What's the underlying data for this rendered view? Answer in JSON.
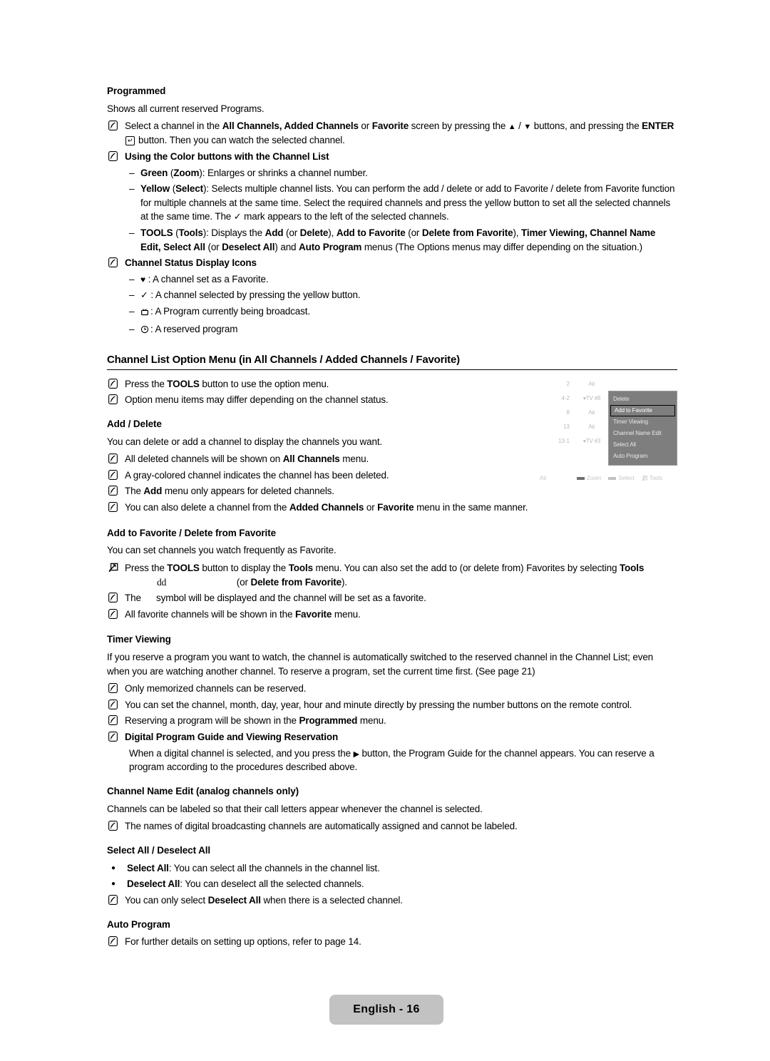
{
  "page": {
    "footer_label": "English - 16"
  },
  "programmed": {
    "heading": "Programmed",
    "intro": "Shows all current reserved Programs.",
    "note1_a": "Select a channel in the ",
    "note1_b": "All Channels, Added Channels",
    "note1_c": " or ",
    "note1_d": "Favorite",
    "note1_e": " screen by pressing the ",
    "note1_up": "▲",
    "note1_slash": " / ",
    "note1_down": "▼",
    "note1_f": " buttons, and pressing the ",
    "note1_enter": "ENTER",
    "note1_enter_glyph": "↵",
    "note1_g": " button. Then you can watch the selected channel.",
    "note2": "Using the Color buttons with the Channel List",
    "dash_green_a": "Green",
    "dash_green_b": " (",
    "dash_green_c": "Zoom",
    "dash_green_d": "): Enlarges or shrinks a channel number.",
    "dash_yellow_a": "Yellow",
    "dash_yellow_b": " (",
    "dash_yellow_c": "Select",
    "dash_yellow_d": "): Selects multiple channel lists. You can perform the add / delete or add to Favorite / delete from Favorite function for multiple channels at the same time. Select the required channels and press the yellow button to set all the selected channels at the same time. The ",
    "dash_yellow_check": "✓",
    "dash_yellow_e": " mark appears to the left of the selected channels.",
    "dash_tools_a": "TOOLS",
    "dash_tools_b": " (",
    "dash_tools_c": "Tools",
    "dash_tools_d": "): Displays the ",
    "dash_tools_add": "Add",
    "dash_tools_e": " (or ",
    "dash_tools_delete": "Delete",
    "dash_tools_f": "), ",
    "dash_tools_atf": "Add to Favorite",
    "dash_tools_g": " (or ",
    "dash_tools_dff": "Delete from Favorite",
    "dash_tools_h": "), ",
    "dash_tools_tv": "Timer Viewing, Channel Name Edit, Select All",
    "dash_tools_i": " (or ",
    "dash_tools_da": "Deselect All",
    "dash_tools_j": ") and ",
    "dash_tools_ap": "Auto Program",
    "dash_tools_k": " menus (The Options menus may differ depending on the situation.)",
    "note3": "Channel Status Display Icons",
    "status_icons": [
      {
        "glyph": "♥",
        "text": ": A channel set as a Favorite."
      },
      {
        "glyph": "✓",
        "text": ": A channel selected by pressing the yellow button."
      },
      {
        "glyph": "tv-icon",
        "text": ": A Program currently being broadcast."
      },
      {
        "glyph": "clock-icon",
        "text": ": A reserved program"
      }
    ]
  },
  "option_menu": {
    "heading": "Channel List Option Menu (in All Channels / Added Channels / Favorite)",
    "note1_a": "Press the ",
    "note1_b": "TOOLS",
    "note1_c": " button to use the option menu.",
    "note2": "Option menu items may differ depending on the channel status."
  },
  "add_delete": {
    "heading": "Add / Delete",
    "intro": "You can delete or add a channel to display the channels you want.",
    "note1_a": "All deleted channels will be shown on ",
    "note1_b": "All Channels",
    "note1_c": " menu.",
    "note2": "A gray-colored channel indicates the channel has been deleted.",
    "note3_a": "The ",
    "note3_b": "Add",
    "note3_c": " menu only appears for deleted channels.",
    "note4_a": "You can also delete a channel from the ",
    "note4_b": "Added Channels",
    "note4_c": " or ",
    "note4_d": "Favorite",
    "note4_e": " menu in the same manner."
  },
  "favorite": {
    "heading": "Add to Favorite / Delete from Favorite",
    "intro": "You can set channels you watch frequently as Favorite.",
    "note1_a": "Press the ",
    "note1_b": "TOOLS",
    "note1_c": " button to display the ",
    "note1_d": "Tools",
    "note1_e": " menu. You can also set the add to (or delete from) Favorites by selecting ",
    "note1_f": "Tools",
    "note1_g2": "dd",
    "note1_h": " (or ",
    "note1_i": "Delete from Favorite",
    "note1_j": ").",
    "note2_a": "The ",
    "note2_b": " symbol will be displayed and the channel will be set as a favorite.",
    "note3_a": "All favorite channels will be shown in the ",
    "note3_b": "Favorite",
    "note3_c": " menu."
  },
  "timer_viewing": {
    "heading": "Timer Viewing",
    "intro": "If you reserve a program you want to watch, the channel is automatically switched to the reserved channel in the Channel List; even when you are watching another channel. To reserve a program, set the current time first. (See page 21)",
    "note1": "Only memorized channels can be reserved.",
    "note2": "You can set the channel, month, day, year, hour and minute directly by pressing the number buttons on the remote control.",
    "note3_a": "Reserving a program will be shown in the ",
    "note3_b": "Programmed",
    "note3_c": " menu.",
    "note4": "Digital Program Guide and Viewing Reservation",
    "sub_a": "When a digital channel is selected, and you press the ",
    "sub_arrow": "▶",
    "sub_b": " button, the Program Guide for the channel appears. You can reserve a program according to the procedures described above."
  },
  "name_edit": {
    "heading": "Channel Name Edit (analog channels only)",
    "intro": "Channels can be labeled so that their call letters appear whenever the channel is selected.",
    "note1": "The names of digital broadcasting channels are automatically assigned and cannot be labeled."
  },
  "select_all": {
    "heading": "Select All / Deselect All",
    "bullet1_a": "Select All",
    "bullet1_b": ": You can select all the channels in the channel list.",
    "bullet2_a": "Deselect All",
    "bullet2_b": ": You can deselect all the selected channels.",
    "note1_a": "You can only select ",
    "note1_b": "Deselect All",
    "note1_c": " when there is a selected channel."
  },
  "auto_program": {
    "heading": "Auto Program",
    "note1": "For further details on setting up options, refer to page 14."
  },
  "tv_figure": {
    "channels": [
      {
        "num": "2",
        "fav": "",
        "name": "Air",
        "extra": ""
      },
      {
        "num": "4-2",
        "fav": "♥",
        "name": "TV #8",
        "extra": ""
      },
      {
        "num": "8",
        "fav": "",
        "name": "Air",
        "extra": ""
      },
      {
        "num": "13",
        "fav": "",
        "name": "Air",
        "extra": ""
      },
      {
        "num": "13-1",
        "fav": "♥",
        "name": "TV #3",
        "extra": "Air"
      }
    ],
    "menu_items": [
      {
        "label": "Delete",
        "selected": false
      },
      {
        "label": "Add to Favorite",
        "selected": true
      },
      {
        "label": "Timer Viewing",
        "selected": false
      },
      {
        "label": "Channel Name Edit",
        "selected": false
      },
      {
        "label": "Select All",
        "selected": false
      },
      {
        "label": "Auto Program",
        "selected": false
      }
    ],
    "status": {
      "source": "Air",
      "zoom_label": "Zoom",
      "select_label": "Select",
      "tools_label": "Tools"
    },
    "colors": {
      "menu_bg": "#7e7e7e",
      "menu_text": "#e8e8e8",
      "channel_text": "#b9b9b9",
      "footer_bg": "#c2c2c2"
    }
  }
}
